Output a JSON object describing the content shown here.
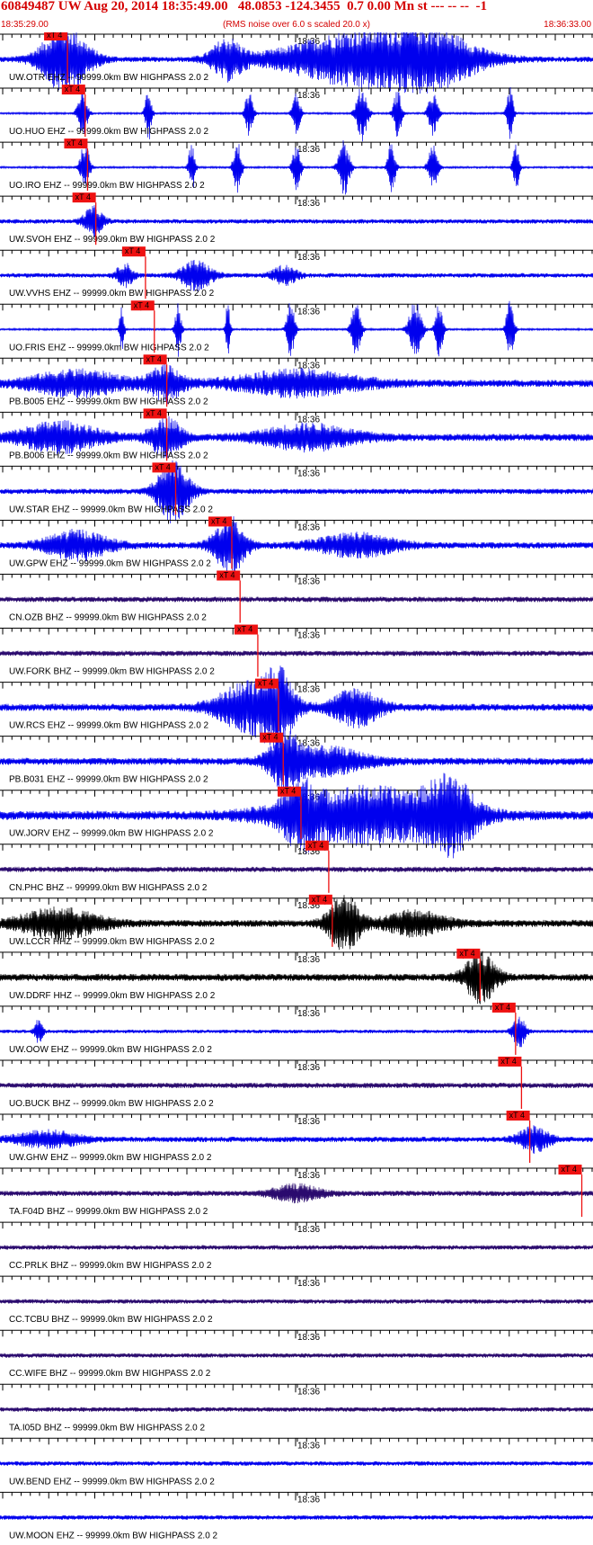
{
  "header": {
    "title": "60849487 UW Aug 20, 2014 18:35:49.00   48.0853 -124.3455  0.7 0.00 Mn st --- -- --  -1",
    "start_time": "18:35:29.00",
    "end_time": "18:36:33.00",
    "note": "(RMS noise over 6.0 s scaled 20.0 x)"
  },
  "minute_label": "18:36",
  "pick_label": "xT 4",
  "colors": {
    "header_text": "#d40000",
    "pick": "#ee1111",
    "axis": "#000000"
  },
  "traces": [
    {
      "label": "UW.OTR EHZ -- 99999.0km BW  HIGHPASS  2.0  2",
      "color": "#0000ee",
      "pick": 0.108,
      "amp": 16,
      "noise": 3,
      "bursts": [
        [
          0.109,
          0.03,
          1.0
        ],
        [
          0.383,
          0.02,
          0.6
        ],
        [
          0.62,
          0.1,
          0.9
        ],
        [
          0.74,
          0.05,
          0.5
        ]
      ]
    },
    {
      "label": "UO.HUO EHZ -- 99999.0km BW  HIGHPASS  2.0  2",
      "color": "#0000ee",
      "pick": 0.138,
      "amp": 14,
      "noise": 1,
      "bursts": [
        [
          0.139,
          0.006,
          0.9
        ],
        [
          0.25,
          0.004,
          1.0
        ],
        [
          0.42,
          0.005,
          0.9
        ],
        [
          0.5,
          0.005,
          0.8
        ],
        [
          0.61,
          0.007,
          1.0
        ],
        [
          0.67,
          0.005,
          0.9
        ],
        [
          0.73,
          0.006,
          0.8
        ],
        [
          0.86,
          0.004,
          1.0
        ]
      ]
    },
    {
      "label": "UO.IRO EHZ -- 99999.0km BW  HIGHPASS  2.0  2",
      "color": "#0000ee",
      "pick": 0.142,
      "amp": 14,
      "noise": 1,
      "bursts": [
        [
          0.143,
          0.006,
          0.9
        ],
        [
          0.323,
          0.004,
          0.9
        ],
        [
          0.4,
          0.005,
          1.0
        ],
        [
          0.5,
          0.005,
          0.9
        ],
        [
          0.58,
          0.007,
          1.0
        ],
        [
          0.66,
          0.005,
          0.9
        ],
        [
          0.73,
          0.006,
          0.8
        ],
        [
          0.87,
          0.004,
          0.9
        ]
      ]
    },
    {
      "label": "UW.SVOH EHZ -- 99999.0km BW  HIGHPASS  2.0  2",
      "color": "#0000ee",
      "pick": 0.156,
      "amp": 12,
      "noise": 2.5,
      "bursts": [
        [
          0.157,
          0.012,
          0.6
        ]
      ]
    },
    {
      "label": "UW.VVHS EHZ -- 99999.0km BW  HIGHPASS  2.0  2",
      "color": "#0000ee",
      "pick": 0.24,
      "amp": 12,
      "noise": 2.5,
      "bursts": [
        [
          0.21,
          0.01,
          0.5
        ],
        [
          0.33,
          0.02,
          0.6
        ],
        [
          0.48,
          0.015,
          0.4
        ]
      ]
    },
    {
      "label": "UO.FRIS EHZ -- 99999.0km BW  HIGHPASS  2.0  2",
      "color": "#0000ee",
      "pick": 0.255,
      "amp": 15,
      "noise": 1,
      "bursts": [
        [
          0.205,
          0.003,
          0.8
        ],
        [
          0.3,
          0.004,
          0.9
        ],
        [
          0.384,
          0.003,
          0.9
        ],
        [
          0.49,
          0.005,
          1.0
        ],
        [
          0.6,
          0.006,
          1.0
        ],
        [
          0.7,
          0.008,
          1.0
        ],
        [
          0.74,
          0.005,
          0.9
        ],
        [
          0.86,
          0.005,
          1.0
        ]
      ]
    },
    {
      "label": "PB.B005 EHZ -- 99999.0km BW  HIGHPASS  2.0  2",
      "color": "#0000ee",
      "pick": 0.276,
      "amp": 12,
      "noise": 4,
      "bursts": [
        [
          0.13,
          0.06,
          0.5
        ],
        [
          0.28,
          0.02,
          0.7
        ],
        [
          0.5,
          0.08,
          0.5
        ]
      ]
    },
    {
      "label": "PB.B006 EHZ -- 99999.0km BW  HIGHPASS  2.0  2",
      "color": "#0000ee",
      "pick": 0.276,
      "amp": 12,
      "noise": 4,
      "bursts": [
        [
          0.1,
          0.05,
          0.6
        ],
        [
          0.28,
          0.02,
          0.8
        ],
        [
          0.52,
          0.06,
          0.5
        ]
      ]
    },
    {
      "label": "UW.STAR EHZ -- 99999.0km BW  HIGHPASS  2.0  2",
      "color": "#0000ee",
      "pick": 0.291,
      "amp": 16,
      "noise": 3,
      "bursts": [
        [
          0.292,
          0.02,
          1.0
        ]
      ]
    },
    {
      "label": "UW.GPW EHZ -- 99999.0km BW  HIGHPASS  2.0  2",
      "color": "#0000ee",
      "pick": 0.386,
      "amp": 14,
      "noise": 3.5,
      "bursts": [
        [
          0.13,
          0.04,
          0.5
        ],
        [
          0.387,
          0.02,
          1.0
        ],
        [
          0.6,
          0.05,
          0.4
        ]
      ]
    },
    {
      "label": "CN.OZB BHZ -- 99999.0km BW  HIGHPASS  2.0  2",
      "color": "#2a0a6e",
      "pick": 0.4,
      "amp": 8,
      "noise": 3,
      "bursts": []
    },
    {
      "label": "UW.FORK BHZ -- 99999.0km BW  HIGHPASS  2.0  2",
      "color": "#2a0a6e",
      "pick": 0.43,
      "amp": 8,
      "noise": 3,
      "bursts": []
    },
    {
      "label": "UW.RCS EHZ -- 99999.0km BW  HIGHPASS  2.0  2",
      "color": "#0000ee",
      "pick": 0.465,
      "amp": 15,
      "noise": 4,
      "bursts": [
        [
          0.42,
          0.04,
          0.8
        ],
        [
          0.47,
          0.02,
          1.0
        ],
        [
          0.6,
          0.03,
          0.6
        ]
      ]
    },
    {
      "label": "PB.B031 EHZ -- 99999.0km BW  HIGHPASS  2.0  2",
      "color": "#0000ee",
      "pick": 0.473,
      "amp": 13,
      "noise": 4,
      "bursts": [
        [
          0.48,
          0.02,
          1.0
        ],
        [
          0.55,
          0.05,
          0.5
        ]
      ]
    },
    {
      "label": "UW.JORV EHZ -- 99999.0km BW  HIGHPASS  2.0  2",
      "color": "#0000ee",
      "pick": 0.503,
      "amp": 15,
      "noise": 5,
      "bursts": [
        [
          0.505,
          0.02,
          0.8
        ],
        [
          0.62,
          0.1,
          0.9
        ],
        [
          0.76,
          0.03,
          1.0
        ]
      ]
    },
    {
      "label": "CN.PHC BHZ -- 99999.0km BW  HIGHPASS  2.0  2",
      "color": "#2a0a6e",
      "pick": 0.55,
      "amp": 8,
      "noise": 3,
      "bursts": []
    },
    {
      "label": "UW.LCCR HHZ -- 99999.0km BW  HIGHPASS  2.0  2",
      "color": "#000000",
      "pick": 0.556,
      "amp": 14,
      "noise": 4,
      "bursts": [
        [
          0.1,
          0.05,
          0.5
        ],
        [
          0.58,
          0.02,
          1.0
        ],
        [
          0.7,
          0.04,
          0.4
        ]
      ]
    },
    {
      "label": "UW.DDRF HHZ -- 99999.0km BW  HIGHPASS  2.0  2",
      "color": "#000000",
      "pick": 0.806,
      "amp": 12,
      "noise": 4,
      "bursts": [
        [
          0.81,
          0.02,
          1.0
        ]
      ]
    },
    {
      "label": "UW.OOW EHZ -- 99999.0km BW  HIGHPASS  2.0  2",
      "color": "#0000ee",
      "pick": 0.866,
      "amp": 10,
      "noise": 2,
      "bursts": [
        [
          0.065,
          0.005,
          0.6
        ],
        [
          0.875,
          0.008,
          0.8
        ]
      ]
    },
    {
      "label": "UO.BUCK BHZ -- 99999.0km BW  HIGHPASS  2.0  2",
      "color": "#2a0a6e",
      "pick": 0.876,
      "amp": 8,
      "noise": 3,
      "bursts": []
    },
    {
      "label": "UW.GHW EHZ -- 99999.0km BW  HIGHPASS  2.0  2",
      "color": "#0000ee",
      "pick": 0.89,
      "amp": 10,
      "noise": 3,
      "bursts": [
        [
          0.08,
          0.04,
          0.4
        ],
        [
          0.9,
          0.02,
          0.6
        ]
      ]
    },
    {
      "label": "TA.F04D BHZ -- 99999.0km BW  HIGHPASS  2.0  2",
      "color": "#2a0a6e",
      "pick": 0.978,
      "amp": 8,
      "noise": 3,
      "bursts": [
        [
          0.5,
          0.03,
          0.5
        ]
      ]
    },
    {
      "label": "CC.PRLK BHZ -- 99999.0km BW  HIGHPASS  2.0  2",
      "color": "#2a0a6e",
      "pick": null,
      "amp": 8,
      "noise": 2.5,
      "bursts": []
    },
    {
      "label": "CC.TCBU BHZ -- 99999.0km BW  HIGHPASS  2.0  2",
      "color": "#2a0a6e",
      "pick": null,
      "amp": 8,
      "noise": 2.5,
      "bursts": []
    },
    {
      "label": "CC.WIFE BHZ -- 99999.0km BW  HIGHPASS  2.0  2",
      "color": "#2a0a6e",
      "pick": null,
      "amp": 8,
      "noise": 2.5,
      "bursts": []
    },
    {
      "label": "TA.I05D BHZ -- 99999.0km BW  HIGHPASS  2.0  2",
      "color": "#2a0a6e",
      "pick": null,
      "amp": 8,
      "noise": 2.5,
      "bursts": []
    },
    {
      "label": "UW.BEND EHZ -- 99999.0km BW  HIGHPASS  2.0  2",
      "color": "#0000ee",
      "pick": null,
      "amp": 8,
      "noise": 2.5,
      "bursts": []
    },
    {
      "label": "UW.MOON EHZ -- 99999.0km BW  HIGHPASS  2.0  2",
      "color": "#0000ee",
      "pick": null,
      "amp": 8,
      "noise": 2.5,
      "bursts": []
    }
  ]
}
